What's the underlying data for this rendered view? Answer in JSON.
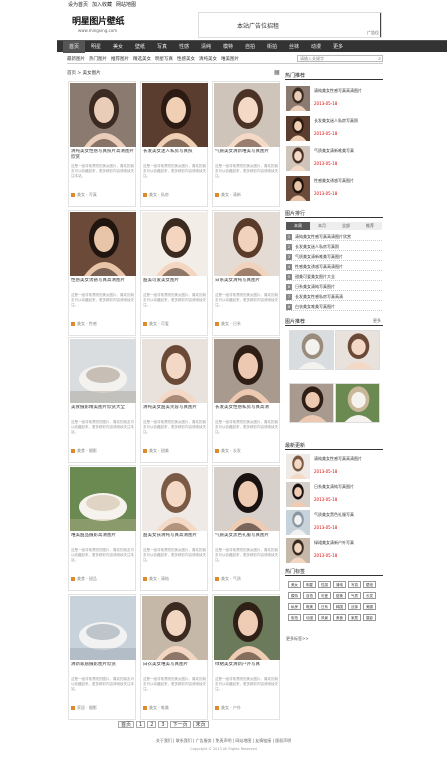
{
  "topbar": {
    "links": [
      "设为首页",
      "加入收藏",
      "网站地图"
    ]
  },
  "header": {
    "logo": "明星图片壁纸",
    "logo_sub": "www.mingxing.com",
    "ad_text": "本站广告位招租",
    "ad_small": "广告位"
  },
  "nav": {
    "items": [
      "首页",
      "明星",
      "美女",
      "壁纸",
      "写真",
      "性感",
      "清纯",
      "模特",
      "自拍",
      "街拍",
      "丝袜",
      "动漫",
      "更多"
    ]
  },
  "subnav": {
    "items": [
      "最新图片",
      "热门图片",
      "推荐图片",
      "精选美女",
      "明星写真",
      "性感美女",
      "清纯美女",
      "唯美图片"
    ],
    "search_placeholder": "请输入关键字"
  },
  "main": {
    "breadcrumb": "首页 > 美女图片",
    "cards": [
      {
        "title": "清纯美女性感写真照片高清图片欣赏",
        "desc": "这是一组非常漂亮的美女图片，喜欢的朋友可以收藏起来，更多精彩内容请继续关注本站。",
        "meta": "美女 · 写真"
      },
      {
        "title": "长发美女迷人私房写真照",
        "desc": "这是一组非常漂亮的美女图片，喜欢的朋友可以收藏起来，更多精彩内容请继续关注。",
        "meta": "美女 · 私房"
      },
      {
        "title": "气质美女清新唯美写真图片",
        "desc": "这是一组非常漂亮的美女图片，喜欢的朋友可以收藏起来，更多精彩内容请继续关注。",
        "meta": "美女 · 清新"
      },
      {
        "title": "性感美女诱惑写真高清图片",
        "desc": "这是一组非常漂亮的美女图片，喜欢的朋友可以收藏起来，更多精彩内容请继续关注。",
        "meta": "美女 · 性感"
      },
      {
        "title": "甜美可爱美女图片",
        "desc": "这是一组非常漂亮的美女图片，喜欢的朋友可以收藏起来，更多精彩内容请继续关注。",
        "meta": "美女 · 可爱"
      },
      {
        "title": "日系美女清纯写真图片",
        "desc": "这是一组非常漂亮的美女图片，喜欢的朋友可以收藏起来，更多精彩内容请继续关注。",
        "meta": "美女 · 日系"
      },
      {
        "title": "美食摄影精美图片欣赏大全",
        "desc": "这是一组非常漂亮的图片，喜欢的朋友可以收藏起来，更多精彩内容请继续关注本站。",
        "meta": "美食 · 摄影"
      },
      {
        "title": "清纯美女甜美笑容写真图片",
        "desc": "这是一组非常漂亮的美女图片，喜欢的朋友可以收藏起来，更多精彩内容请继续关注。",
        "meta": "美女 · 甜美"
      },
      {
        "title": "长发美女性感私房写真高清",
        "desc": "这是一组非常漂亮的美女图片，喜欢的朋友可以收藏起来，更多精彩内容请继续关注。",
        "meta": "美女 · 长发"
      },
      {
        "title": "唯美甜品摄影高清图片",
        "desc": "这是一组非常漂亮的图片，喜欢的朋友可以收藏起来，更多精彩内容请继续关注本站。",
        "meta": "美食 · 甜品"
      },
      {
        "title": "甜美女孩清纯写真高清图片",
        "desc": "这是一组非常漂亮的美女图片，喜欢的朋友可以收藏起来，更多精彩内容请继续关注。",
        "meta": "美女 · 清纯"
      },
      {
        "title": "气质美女黑色礼服写真图片",
        "desc": "这是一组非常漂亮的美女图片，喜欢的朋友可以收藏起来，更多精彩内容请继续关注。",
        "meta": "美女 · 气质"
      },
      {
        "title": "清新家居摄影图片欣赏",
        "desc": "这是一组非常漂亮的图片，喜欢的朋友可以收藏起来，更多精彩内容请继续关注本站。",
        "meta": "家居 · 摄影"
      },
      {
        "title": "白衣美女唯美写真图片",
        "desc": "这是一组非常漂亮的美女图片，喜欢的朋友可以收藏起来，更多精彩内容请继续关注。",
        "meta": "美女 · 唯美"
      },
      {
        "title": "绿裙美女清新户外写真",
        "desc": "这是一组非常漂亮的美女图片，喜欢的朋友可以收藏起来，更多精彩内容请继续关注。",
        "meta": "美女 · 户外"
      }
    ],
    "pager": [
      "首页",
      "1",
      "2",
      "3",
      "下一页",
      "末页"
    ]
  },
  "sidebar": {
    "hot_title": "热门推荐",
    "hot": [
      {
        "title": "清纯美女性感写真高清图片",
        "date": "2013-05-18"
      },
      {
        "title": "长发美女迷人私房写真照",
        "date": "2013-05-18"
      },
      {
        "title": "气质美女清新唯美写真",
        "date": "2013-05-18"
      },
      {
        "title": "性感美女诱惑写真图片",
        "date": "2013-05-18"
      }
    ],
    "rank_title": "图片排行",
    "tabs": [
      "本周",
      "本月",
      "全部",
      "推荐"
    ],
    "ranks": [
      "清纯美女性感写真高清图片欣赏",
      "长发美女迷人私房写真照",
      "气质美女清新唯美写真图片",
      "性感美女诱惑写真高清图片",
      "甜美可爱美女图片大全",
      "日系美女清纯写真图片",
      "长发美女性感私房写真高清",
      "白衣美女唯美写真图片"
    ],
    "pic_title": "图片推荐",
    "pic_more": "更多",
    "latest_title": "最新更新",
    "latest": [
      {
        "title": "清纯美女性感写真高清图片",
        "date": "2013-05-18"
      },
      {
        "title": "日系美女清纯写真图片",
        "date": "2013-05-18"
      },
      {
        "title": "气质美女黑色礼服写真",
        "date": "2013-05-18"
      },
      {
        "title": "绿裙美女清新户外写真",
        "date": "2013-05-18"
      }
    ],
    "tag_title": "热门标签",
    "tags": [
      "美女",
      "明星",
      "性感",
      "清纯",
      "写真",
      "壁纸",
      "模特",
      "自拍",
      "可爱",
      "甜美",
      "气质",
      "长发",
      "私房",
      "唯美",
      "日系",
      "韩国",
      "丝袜",
      "美腿",
      "街拍",
      "动漫",
      "风景",
      "美食",
      "家居",
      "摄影"
    ],
    "more_tags": "更多标签>>"
  },
  "footer": {
    "links": [
      "关于我们",
      "联系我们",
      "广告服务",
      "免责声明",
      "网站地图",
      "友情链接",
      "版权声明"
    ],
    "copyright": "Copyright © 2013 All Rights Reserved"
  }
}
